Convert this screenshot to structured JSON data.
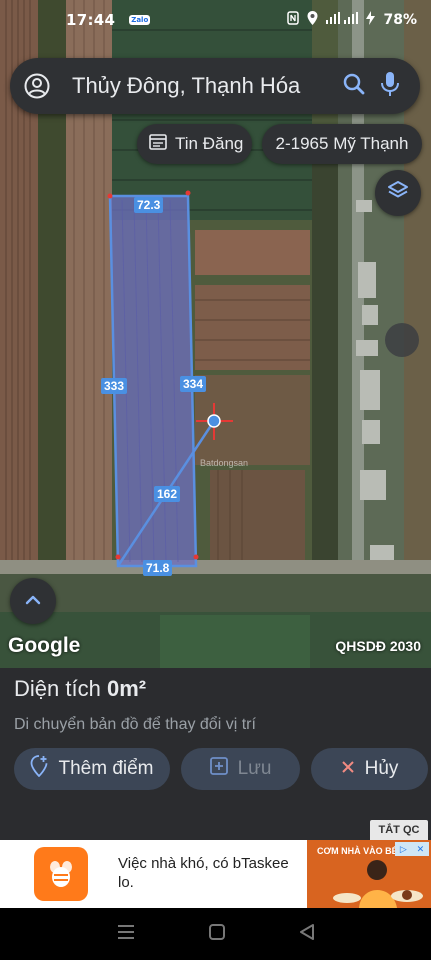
{
  "status_bar": {
    "time": "17:44",
    "zalo_badge": "Zalo",
    "battery": "78%"
  },
  "search": {
    "query": "Thủy Đông, Thạnh Hóa"
  },
  "chips": {
    "listing_label": "Tin Đăng",
    "listing_icon": "listing-icon",
    "parcel_label": "2-1965 Mỹ Thạnh"
  },
  "map": {
    "dimensions": {
      "top": "72.3",
      "left": "333",
      "right": "334",
      "diagonal": "162",
      "bottom": "71.8"
    },
    "watermark": "Batdongsan",
    "google_logo": "Google",
    "overlay_label": "QHSDĐ 2030",
    "accent_color": "#4a90e2",
    "marker_color": "#e53935"
  },
  "panel": {
    "area_label": "Diện tích",
    "area_value": "0m²",
    "hint": "Di chuyển bản đồ để thay đổi vị trí",
    "add_point": "Thêm điểm",
    "save": "Lưu",
    "cancel": "Hủy"
  },
  "ad": {
    "dismiss": "TẮT QC",
    "text": "Việc nhà khó, có bTaskee lo.",
    "image_caption": "CƠM NHÀ VÀO BẾP"
  }
}
